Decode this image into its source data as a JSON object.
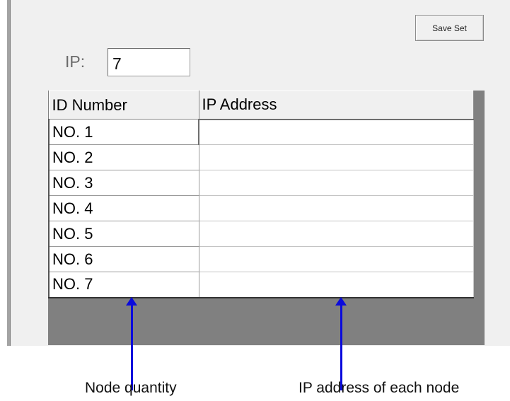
{
  "toolbar": {
    "save_label": "Save Set"
  },
  "ip_field": {
    "label": "IP:",
    "value": "7"
  },
  "table": {
    "headers": [
      "ID Number",
      "IP Address"
    ],
    "rows": [
      {
        "id": "NO. 1",
        "ip": ""
      },
      {
        "id": "NO. 2",
        "ip": ""
      },
      {
        "id": "NO. 3",
        "ip": ""
      },
      {
        "id": "NO. 4",
        "ip": ""
      },
      {
        "id": "NO. 5",
        "ip": ""
      },
      {
        "id": "NO. 6",
        "ip": ""
      },
      {
        "id": "NO. 7",
        "ip": ""
      }
    ]
  },
  "annotations": {
    "left": "Node quantity",
    "right": "IP address of each node",
    "color": "#0a0adc"
  }
}
